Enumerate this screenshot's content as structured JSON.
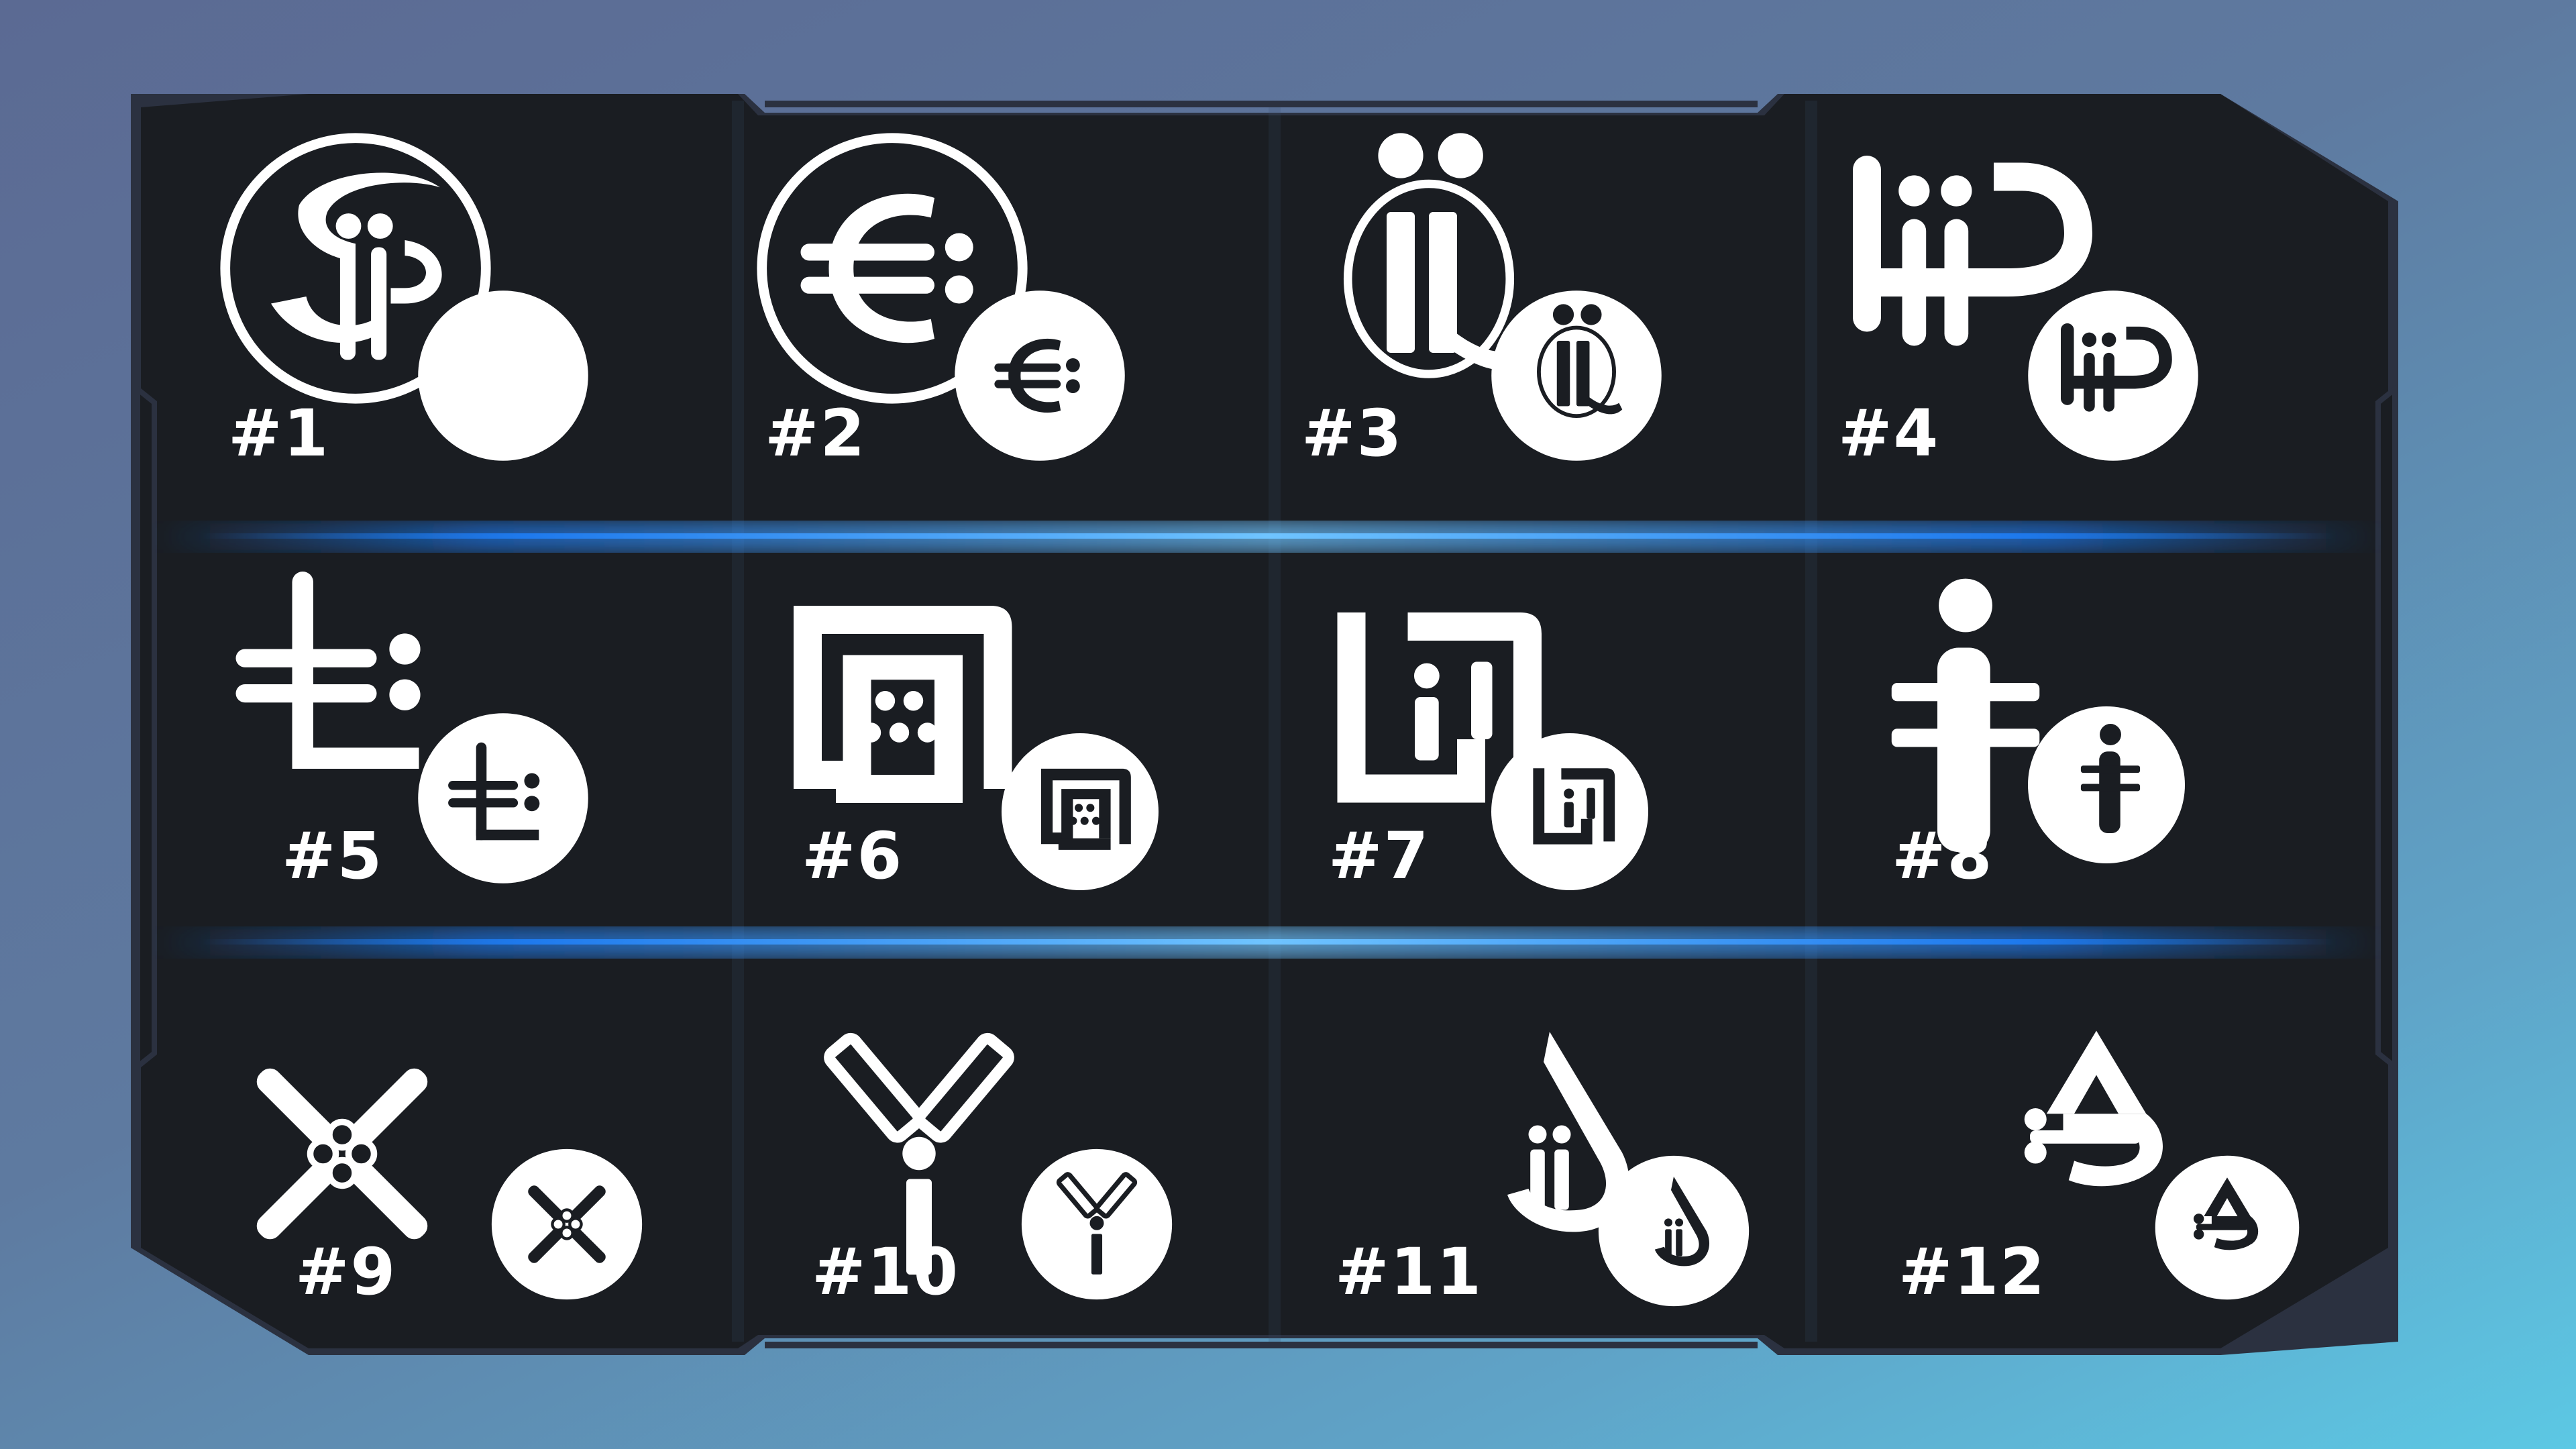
{
  "colors": {
    "panel": "#1a1d22",
    "panel_border": "#2b3140",
    "glow": "#1e7df5",
    "glyph": "#ffffff"
  },
  "tiles": [
    {
      "number": "#1",
      "icon": "dollar-ij-monogram-icon"
    },
    {
      "number": "#2",
      "icon": "euro-colon-monogram-icon"
    },
    {
      "number": "#3",
      "icon": "umlaut-q-monogram-icon"
    },
    {
      "number": "#4",
      "icon": "iid-monogram-icon"
    },
    {
      "number": "#5",
      "icon": "hook-colon-glyph-icon"
    },
    {
      "number": "#6",
      "icon": "interlocked-m-monogram-icon"
    },
    {
      "number": "#7",
      "icon": "framed-i-monogram-icon"
    },
    {
      "number": "#8",
      "icon": "barred-i-glyph-icon"
    },
    {
      "number": "#9",
      "icon": "crossed-swords-icon"
    },
    {
      "number": "#10",
      "icon": "y-antibody-glyph-icon"
    },
    {
      "number": "#11",
      "icon": "drop-ij-glyph-icon"
    },
    {
      "number": "#12",
      "icon": "triangle-three-glyph-icon"
    }
  ]
}
